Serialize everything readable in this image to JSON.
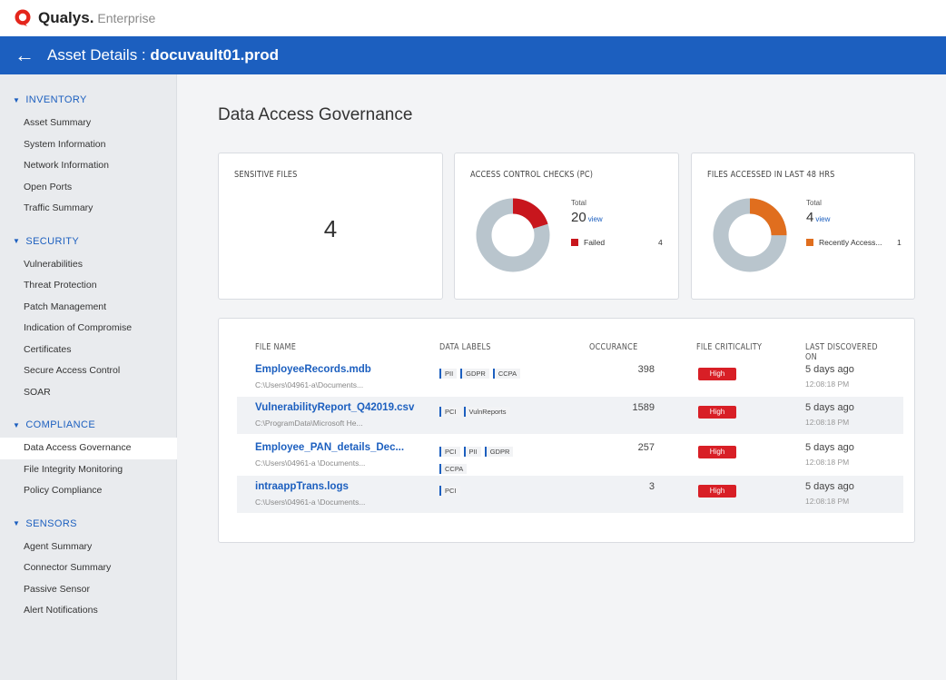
{
  "brand": {
    "name": "Qualys.",
    "suffix": "Enterprise"
  },
  "header": {
    "prefix": "Asset Details : ",
    "asset": "docuvault01.prod"
  },
  "colors": {
    "primary": "#1c5fbf",
    "danger": "#d81f26",
    "orange": "#e06e1e",
    "donut_gray": "#b9c5cd"
  },
  "sidebar": {
    "sections": [
      {
        "title": "INVENTORY",
        "items": [
          "Asset Summary",
          "System Information",
          "Network Information",
          "Open Ports",
          "Traffic Summary"
        ]
      },
      {
        "title": "SECURITY",
        "items": [
          "Vulnerabilities",
          "Threat Protection",
          "Patch Management",
          "Indication of Compromise",
          "Certificates",
          "Secure Access Control",
          "SOAR"
        ]
      },
      {
        "title": "COMPLIANCE",
        "items": [
          "Data Access Governance",
          "File Integrity Monitoring",
          "Policy Compliance"
        ]
      },
      {
        "title": "SENSORS",
        "items": [
          "Agent Summary",
          "Connector Summary",
          "Passive Sensor",
          "Alert Notifications"
        ]
      }
    ],
    "active": "Data Access Governance"
  },
  "page": {
    "title": "Data Access Governance"
  },
  "cards": {
    "sensitive": {
      "title": "SENSITIVE FILES",
      "value": "4"
    },
    "access": {
      "title": "ACCESS CONTROL CHECKS (PC)",
      "total_label": "Total",
      "total": "20",
      "view": "view",
      "legend": "Failed",
      "legend_count": "4",
      "fraction": 0.2
    },
    "files48": {
      "title": "FILES ACCESSED IN LAST 48 HRS",
      "total_label": "Total",
      "total": "4",
      "view": "view",
      "legend": "Recently Access...",
      "legend_count": "1",
      "fraction": 0.25
    }
  },
  "table": {
    "headers": {
      "name": "FILE NAME",
      "labels": "DATA LABELS",
      "occ": "OCCURANCE",
      "crit": "FILE CRITICALITY",
      "disc": "LAST DISCOVERED ON"
    },
    "rows": [
      {
        "name": "EmployeeRecords.mdb",
        "path": "C:\\Users\\04961-a\\Documents...",
        "tags": [
          "PII",
          "GDPR",
          "CCPA"
        ],
        "occ": "398",
        "crit": "High",
        "disc": "5 days ago",
        "time": "12:08:18 PM"
      },
      {
        "name": "VulnerabilityReport_Q42019.csv",
        "path": "C:\\ProgramData\\Microsoft He...",
        "tags": [
          "PCI",
          "VulnReports"
        ],
        "occ": "1589",
        "crit": "High",
        "disc": "5 days ago",
        "time": "12:08:18 PM"
      },
      {
        "name": "Employee_PAN_details_Dec...",
        "path": "C:\\Users\\04961-a \\Documents...",
        "tags": [
          "PCI",
          "PII",
          "GDPR",
          "CCPA"
        ],
        "occ": "257",
        "crit": "High",
        "disc": "5 days ago",
        "time": "12:08:18 PM"
      },
      {
        "name": "intraappTrans.logs",
        "path": "C:\\Users\\04961-a \\Documents...",
        "tags": [
          "PCI"
        ],
        "occ": "3",
        "crit": "High",
        "disc": "5 days ago",
        "time": "12:08:18 PM"
      }
    ]
  }
}
